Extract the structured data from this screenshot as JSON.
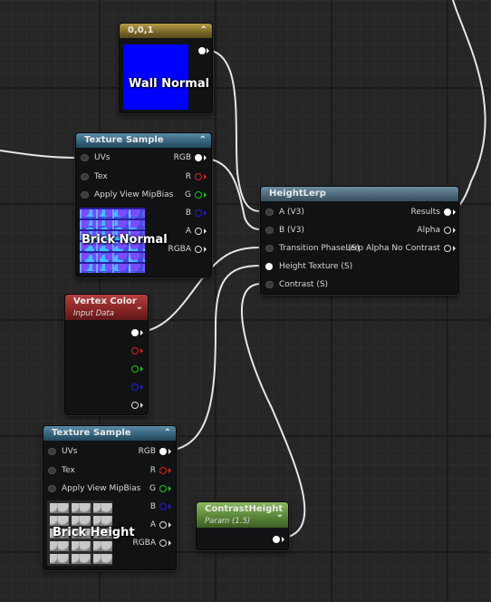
{
  "nodes": {
    "constant": {
      "title": "0,0,1",
      "preview_label": "Wall Normal",
      "preview_color": "#0000ff"
    },
    "tex1": {
      "title": "Texture Sample",
      "inputs": [
        "UVs",
        "Tex",
        "Apply View MipBias"
      ],
      "outputs": [
        "RGB",
        "R",
        "G",
        "B",
        "A",
        "RGBA"
      ],
      "preview_label": "Brick Normal"
    },
    "heightlerp": {
      "title": "HeightLerp",
      "inputs": [
        "A (V3)",
        "B (V3)",
        "Transition Phase (S)",
        "Height Texture (S)",
        "Contrast (S)"
      ],
      "outputs": [
        "Results",
        "Alpha",
        "Lerp Alpha No Contrast"
      ]
    },
    "vertex": {
      "title": "Vertex Color",
      "subtitle": "Input Data"
    },
    "tex2": {
      "title": "Texture Sample",
      "inputs": [
        "UVs",
        "Tex",
        "Apply View MipBias"
      ],
      "outputs": [
        "RGB",
        "R",
        "G",
        "B",
        "A",
        "RGBA"
      ],
      "preview_label": "Brick Height"
    },
    "contrast": {
      "title": "ContrastHeight",
      "subtitle": "Param (1.5)"
    }
  },
  "colors": {
    "texture_header": "#2f5a72",
    "constant_header": "#6f5e24",
    "vertex_header": "#7e2020",
    "param_header": "#4f7a30",
    "function_header": "#455f70",
    "wire": "#e8e8e8"
  }
}
